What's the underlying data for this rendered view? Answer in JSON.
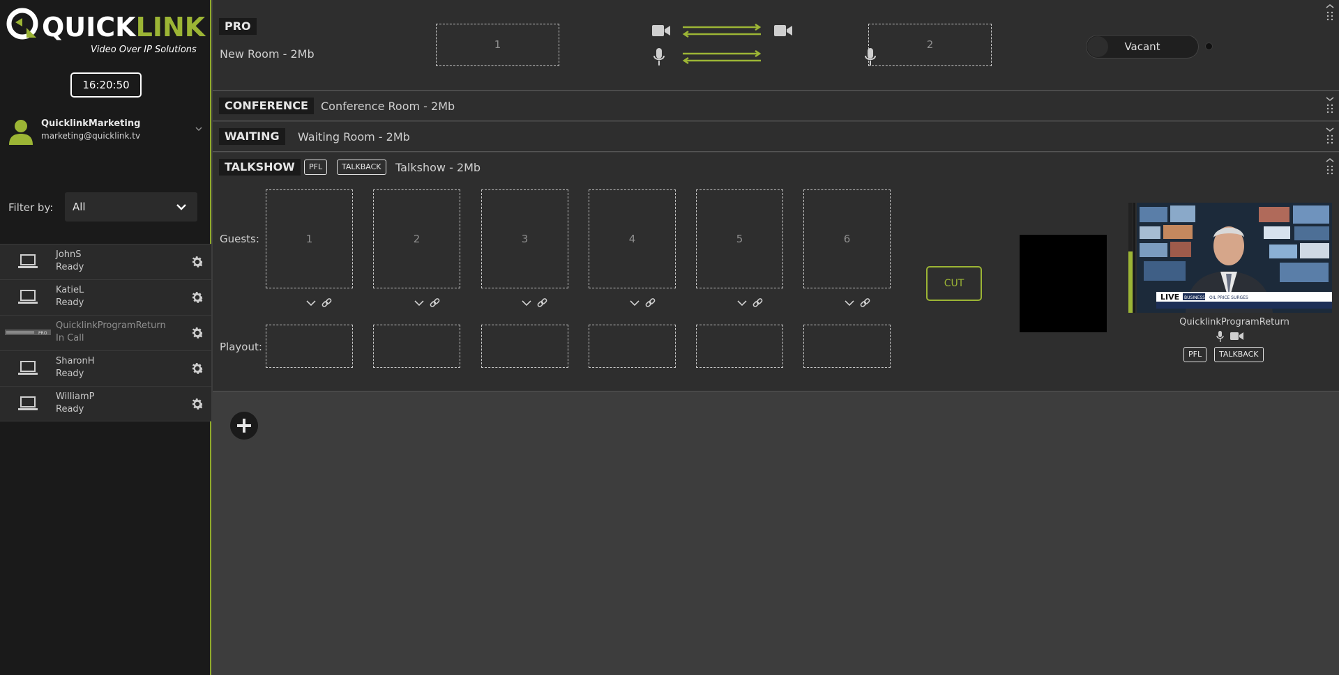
{
  "sidebar": {
    "logo": {
      "quick": "QUICK",
      "link": "LINK",
      "tagline": "Video Over IP Solutions"
    },
    "clock": "16:20:50",
    "user": {
      "name": "QuicklinkMarketing",
      "email": "marketing@quicklink.tv"
    },
    "filter": {
      "label": "Filter by:",
      "value": "All"
    },
    "participants": [
      {
        "name": "JohnS",
        "status": "Ready",
        "device": "laptop-icon"
      },
      {
        "name": "KatieL",
        "status": "Ready",
        "device": "laptop-icon"
      },
      {
        "name": "QuicklinkProgramReturn",
        "status": "In Call",
        "device": "pro-device-icon",
        "device_label": "PRO"
      },
      {
        "name": "SharonH",
        "status": "Ready",
        "device": "laptop-icon"
      },
      {
        "name": "WilliamP",
        "status": "Ready",
        "device": "laptop-icon"
      }
    ]
  },
  "rooms": {
    "pro": {
      "tag": "PRO",
      "name": "New Room - 2Mb",
      "slots": [
        "1",
        "2"
      ],
      "toggle_label": "Vacant"
    },
    "conference": {
      "tag": "CONFERENCE",
      "name": "Conference Room - 2Mb"
    },
    "waiting": {
      "tag": "WAITING",
      "name": "Waiting Room - 2Mb"
    },
    "talkshow": {
      "tag": "TALKSHOW",
      "pfl": "PFL",
      "talkback": "TALKBACK",
      "name": "Talkshow - 2Mb",
      "guests_label": "Guests:",
      "playout_label": "Playout:",
      "guests": [
        "1",
        "2",
        "3",
        "4",
        "5",
        "6"
      ],
      "cut_label": "CUT",
      "program": {
        "name": "QuicklinkProgramReturn",
        "pfl": "PFL",
        "talkback": "TALKBACK",
        "live_label": "LIVE",
        "channel_label": "BUSINESS",
        "ticker": "OIL PRICE SURGES",
        "audio_level": 0.56
      }
    }
  },
  "colors": {
    "accent": "#9cb535",
    "sidebar_bg": "#1a1a1a",
    "room_bg": "#2e2e2e",
    "main_bg": "#3d3d3d"
  }
}
